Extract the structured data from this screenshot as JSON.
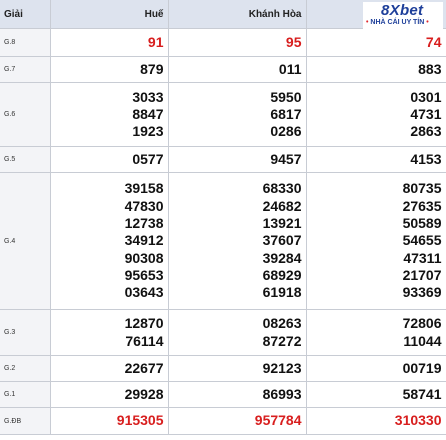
{
  "header": {
    "giai": "Giải",
    "provinces": [
      "Huế",
      "Khánh Hòa",
      ""
    ]
  },
  "logo": {
    "brand": "8Xbet",
    "tagline": "NHÀ CÁI UY TÍN"
  },
  "rows": [
    {
      "label": "G.8",
      "cols": [
        [
          "91"
        ],
        [
          "95"
        ],
        [
          "74"
        ]
      ]
    },
    {
      "label": "G.7",
      "cols": [
        [
          "879"
        ],
        [
          "011"
        ],
        [
          "883"
        ]
      ]
    },
    {
      "label": "G.6",
      "cols": [
        [
          "3033",
          "8847",
          "1923"
        ],
        [
          "5950",
          "6817",
          "0286"
        ],
        [
          "0301",
          "4731",
          "2863"
        ]
      ]
    },
    {
      "label": "G.5",
      "cols": [
        [
          "0577"
        ],
        [
          "9457"
        ],
        [
          "4153"
        ]
      ]
    },
    {
      "label": "G.4",
      "cols": [
        [
          "39158",
          "47830",
          "12738",
          "34912",
          "90308",
          "95653",
          "03643"
        ],
        [
          "68330",
          "24682",
          "13921",
          "37607",
          "39284",
          "68929",
          "61918"
        ],
        [
          "80735",
          "27635",
          "50589",
          "54655",
          "47311",
          "21707",
          "93369"
        ]
      ]
    },
    {
      "label": "G.3",
      "cols": [
        [
          "12870",
          "76114"
        ],
        [
          "08263",
          "87272"
        ],
        [
          "72806",
          "11044"
        ]
      ]
    },
    {
      "label": "G.2",
      "cols": [
        [
          "22677"
        ],
        [
          "92123"
        ],
        [
          "00719"
        ]
      ]
    },
    {
      "label": "G.1",
      "cols": [
        [
          "29928"
        ],
        [
          "86993"
        ],
        [
          "58741"
        ]
      ]
    },
    {
      "label": "G.ĐB",
      "cols": [
        [
          "915305"
        ],
        [
          "957784"
        ],
        [
          "310330"
        ]
      ]
    }
  ],
  "colors": {
    "special": "#d81e1e",
    "header_bg": "#dde3ee",
    "label_bg": "#f3f4f7",
    "brand": "#1e3f9a"
  }
}
